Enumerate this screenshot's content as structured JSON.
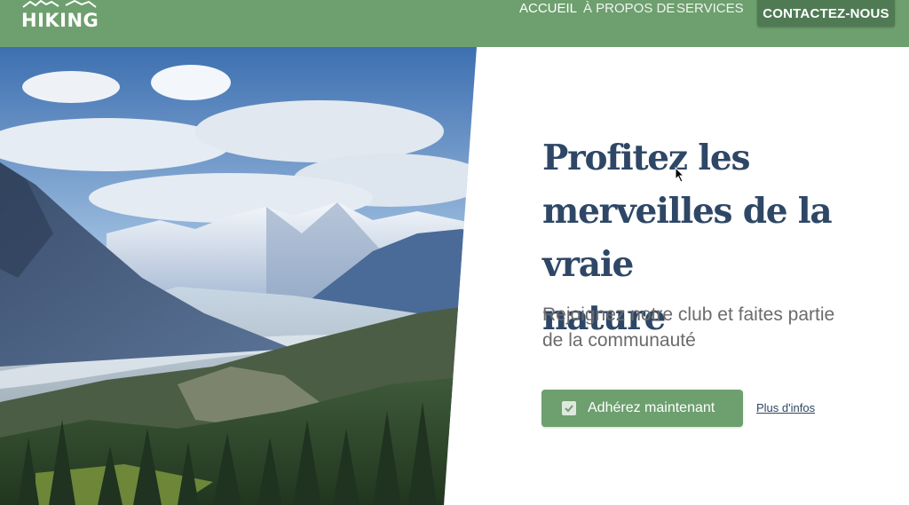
{
  "brand": {
    "name": "HIKING"
  },
  "nav": {
    "items": [
      {
        "label": "ACCUEIL",
        "active": true
      },
      {
        "label": "À PROPOS DE",
        "active": false
      },
      {
        "label": "SERVICES",
        "active": false
      }
    ],
    "cta_label": "CONTACTEZ-NOUS"
  },
  "hero": {
    "title_lines": [
      "Profitez les",
      "merveilles de la vraie",
      "nature"
    ],
    "subtitle_lines": [
      "Rejoignez notre club et faites partie",
      "de la communauté"
    ],
    "primary_button": "Adhérez maintenant",
    "secondary_link": "Plus d'infos",
    "image_alt_icon": "mountain-landscape"
  },
  "colors": {
    "header_bg": "#6e9f6e",
    "cta_bg": "#4f7a54",
    "title": "#2e4766",
    "subtitle": "#6b6b6b",
    "button_bg": "#6e9f6e"
  },
  "icons": {
    "logo": "mountain-logo-icon",
    "button": "check-icon",
    "cursor": "cursor-icon"
  }
}
